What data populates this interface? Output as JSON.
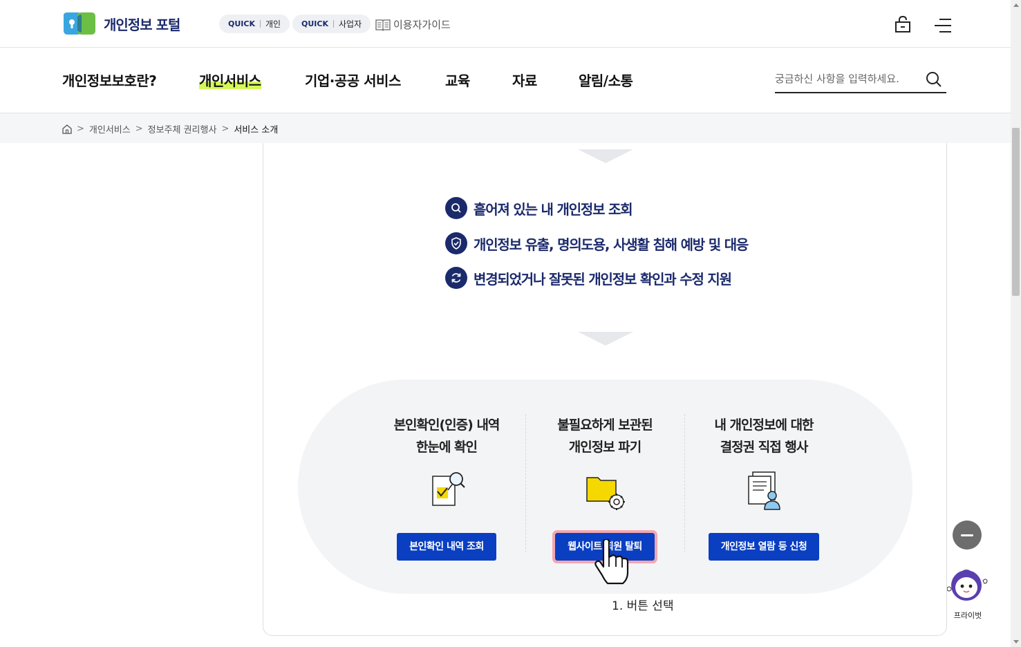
{
  "header": {
    "logo_text": "개인정보 포털",
    "quick_personal": {
      "tag": "QUICK",
      "label": "개인"
    },
    "quick_business": {
      "tag": "QUICK",
      "label": "사업자"
    },
    "guide_label": "이용자가이드"
  },
  "gnb": {
    "items": [
      "개인정보보호란?",
      "개인서비스",
      "기업·공공 서비스",
      "교육",
      "자료",
      "알림/소통"
    ],
    "active_index": 1,
    "search_placeholder": "궁금하신 사항을 입력하세요."
  },
  "breadcrumb": {
    "items": [
      "개인서비스",
      "정보주체 권리행사"
    ],
    "current": "서비스 소개"
  },
  "features": [
    {
      "icon": "search-icon",
      "text": "흩어져 있는 내 개인정보 조회"
    },
    {
      "icon": "shield-icon",
      "text": "개인정보 유출, 명의도용, 사생활 침해 예방 및 대응"
    },
    {
      "icon": "refresh-icon",
      "text": "변경되었거나 잘못된 개인정보 확인과 수정 지원"
    }
  ],
  "services": [
    {
      "title_line1": "본인확인(인증) 내역",
      "title_line2": "한눈에 확인",
      "icon": "document-check-icon",
      "button": "본인확인 내역 조회"
    },
    {
      "title_line1": "불필요하게 보관된",
      "title_line2": "개인정보 파기",
      "icon": "folder-gear-icon",
      "button": "웹사이트 회원 탈퇴"
    },
    {
      "title_line1": "내 개인정보에 대한",
      "title_line2": "결정권 직접 행사",
      "icon": "document-user-icon",
      "button": "개인정보 열람 등 신청"
    }
  ],
  "caption": "1. 버튼 선택",
  "chatbot_label": "프라이벗",
  "colors": {
    "navy": "#1b2a6b",
    "button_blue": "#0a3fc2",
    "highlight": "#d3f75b",
    "button_outline": "#f4a7b0"
  }
}
